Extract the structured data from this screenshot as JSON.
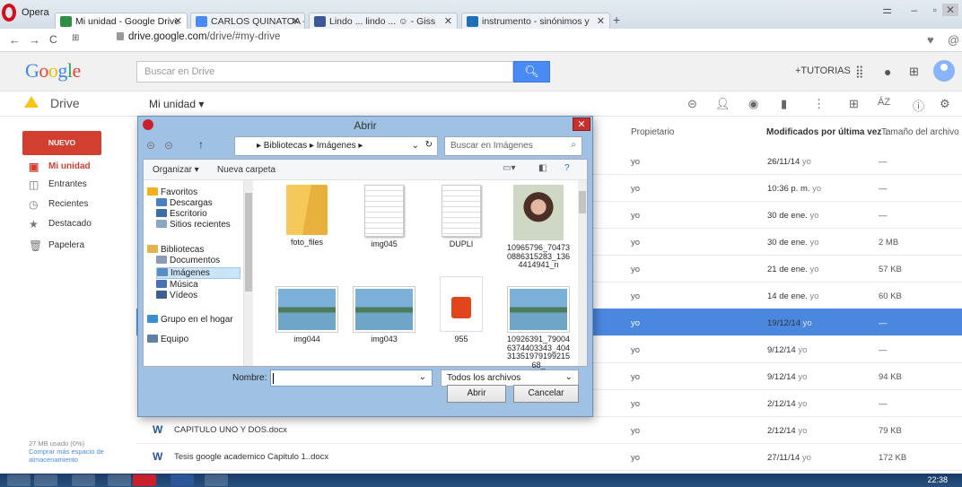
{
  "browser": {
    "app_name": "Opera",
    "tabs": [
      {
        "label": "Mi unidad - Google Drive",
        "color": "#2f8f46"
      },
      {
        "label": "CARLOS QUINATOA - Doc",
        "color": "#4a8af4"
      },
      {
        "label": "Lindo ... lindo ... ☺ - Giss",
        "color": "#3b5998"
      },
      {
        "label": "instrumento - sinónimos y",
        "color": "#1e6fb5"
      }
    ],
    "new_tab": "+",
    "url_host": "drive.google.com",
    "url_path": "/drive/#my-drive"
  },
  "google": {
    "logo": "Google",
    "search_placeholder": "Buscar en Drive",
    "tutorias": "+TUTORIAS"
  },
  "drive": {
    "app_label": "Drive",
    "location": "Mi unidad ▾",
    "new_button": "NUEVO",
    "sidebar": [
      {
        "label": "Mi unidad",
        "icon": "▣"
      },
      {
        "label": "Entrantes",
        "icon": "◫"
      },
      {
        "label": "Recientes",
        "icon": "◷"
      },
      {
        "label": "Destacado",
        "icon": "★"
      },
      {
        "label": "Papelera",
        "icon": "🗑"
      }
    ],
    "storage_used": "27 MB usado (0%)",
    "storage_link": "Comprar más espacio de almacenamiento",
    "columns": {
      "owner": "Propietario",
      "modified": "Modificados por última vez ↓",
      "size": "Tamaño del archivo"
    },
    "rows": [
      {
        "name": "",
        "owner": "yo",
        "date": "26/11/14",
        "by": "yo",
        "size": "—"
      },
      {
        "name": "",
        "owner": "yo",
        "date": "10:36 p. m.",
        "by": "yo",
        "size": "—"
      },
      {
        "name": "",
        "owner": "yo",
        "date": "30 de ene.",
        "by": "yo",
        "size": "—"
      },
      {
        "name": "",
        "owner": "yo",
        "date": "30 de ene.",
        "by": "yo",
        "size": "2 MB"
      },
      {
        "name": "",
        "owner": "yo",
        "date": "21 de ene.",
        "by": "yo",
        "size": "57 KB"
      },
      {
        "name": "",
        "owner": "yo",
        "date": "14 de ene.",
        "by": "yo",
        "size": "60 KB"
      },
      {
        "name": "",
        "owner": "yo",
        "date": "19/12/14",
        "by": "yo",
        "size": "—"
      },
      {
        "name": "",
        "owner": "yo",
        "date": "9/12/14",
        "by": "yo",
        "size": "—"
      },
      {
        "name": "",
        "owner": "yo",
        "date": "9/12/14",
        "by": "yo",
        "size": "94 KB"
      },
      {
        "name": "",
        "owner": "yo",
        "date": "2/12/14",
        "by": "yo",
        "size": "—"
      },
      {
        "name": "CAPITULO UNO Y DOS.docx",
        "owner": "yo",
        "date": "2/12/14",
        "by": "yo",
        "size": "79 KB"
      },
      {
        "name": "Tesis google academico Capitulo 1..docx",
        "owner": "yo",
        "date": "27/11/14",
        "by": "yo",
        "size": "172 KB"
      }
    ],
    "selected_row": 6
  },
  "dialog": {
    "title": "Abrir",
    "breadcrumb": "▸ Bibliotecas ▸ Imágenes ▸",
    "search_placeholder": "Buscar en Imágenes",
    "organize": "Organizar ▾",
    "new_folder": "Nueva carpeta",
    "tree": [
      {
        "label": "Favoritos",
        "color": "#f2b01e",
        "indent": 0
      },
      {
        "label": "Descargas",
        "color": "#4a7fc1",
        "indent": 1
      },
      {
        "label": "Escritorio",
        "color": "#3a6ea5",
        "indent": 1
      },
      {
        "label": "Sitios recientes",
        "color": "#8aa6c4",
        "indent": 1
      },
      {
        "label": "Bibliotecas",
        "color": "#e2b34b",
        "indent": 0
      },
      {
        "label": "Documentos",
        "color": "#8a9bb3",
        "indent": 1
      },
      {
        "label": "Imágenes",
        "color": "#5b8cc2",
        "indent": 1
      },
      {
        "label": "Música",
        "color": "#4a6fb5",
        "indent": 1
      },
      {
        "label": "Vídeos",
        "color": "#3d5f8f",
        "indent": 1
      },
      {
        "label": "Grupo en el hogar",
        "color": "#3a8fd1",
        "indent": 0
      },
      {
        "label": "Equipo",
        "color": "#5f7fa3",
        "indent": 0
      }
    ],
    "files": [
      {
        "label": "foto_files",
        "kind": "folder"
      },
      {
        "label": "img045",
        "kind": "doc"
      },
      {
        "label": "DUPLI",
        "kind": "doc"
      },
      {
        "label": "10965796_704730886315283_1364414941_n",
        "kind": "photo"
      },
      {
        "label": "img044",
        "kind": "land"
      },
      {
        "label": "img043",
        "kind": "land"
      },
      {
        "label": "955",
        "kind": "pdf"
      },
      {
        "label": "10926391_790046374403343_4043135197919921568_",
        "kind": "land"
      }
    ],
    "name_label": "Nombre:",
    "name_value": "",
    "file_type": "Todos los archivos",
    "open_button": "Abrir",
    "cancel_button": "Cancelar"
  },
  "taskbar": {
    "clock": "22:38"
  }
}
